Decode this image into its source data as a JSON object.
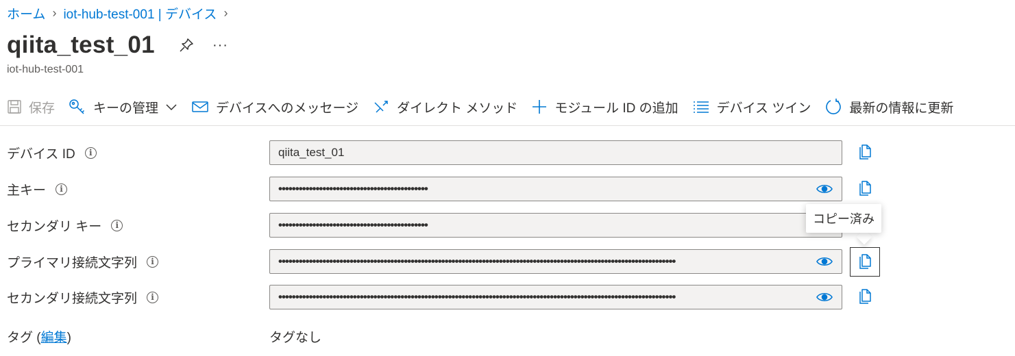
{
  "breadcrumb": {
    "items": [
      "ホーム",
      "iot-hub-test-001 | デバイス"
    ]
  },
  "header": {
    "title": "qiita_test_01",
    "subtitle": "iot-hub-test-001",
    "more_label": "···"
  },
  "toolbar": {
    "save": "保存",
    "manage_keys": "キーの管理",
    "message_to_device": "デバイスへのメッセージ",
    "direct_method": "ダイレクト メソッド",
    "add_module_identity": "モジュール ID の追加",
    "device_twin": "デバイス ツイン",
    "refresh": "最新の情報に更新"
  },
  "fields": {
    "device_id": {
      "label": "デバイス ID",
      "value": "qiita_test_01"
    },
    "primary_key": {
      "label": "主キー",
      "value": "••••••••••••••••••••••••••••••••••••••••••••"
    },
    "secondary_key": {
      "label": "セカンダリ キー",
      "value": "••••••••••••••••••••••••••••••••••••••••••••"
    },
    "primary_conn": {
      "label": "プライマリ接続文字列",
      "value": "•••••••••••••••••••••••••••••••••••••••••••••••••••••••••••••••••••••••••••••••••••••••••••••••••••••••••••••••••••••"
    },
    "secondary_conn": {
      "label": "セカンダリ接続文字列",
      "value": "•••••••••••••••••••••••••••••••••••••••••••••••••••••••••••••••••••••••••••••••••••••••••••••••••••••••••••••••••••••"
    }
  },
  "tooltip": {
    "text": "コピー済み"
  },
  "tags": {
    "label_prefix": "タグ (",
    "edit_link": "編集",
    "label_suffix": ")",
    "value": "タグなし"
  },
  "colors": {
    "accent": "#0078d4",
    "text": "#323130",
    "field_bg": "#f3f2f1",
    "disabled": "#a19f9d"
  },
  "icons": [
    "save-icon",
    "key-icon",
    "mail-icon",
    "direct-method-icon",
    "plus-icon",
    "list-icon",
    "refresh-icon",
    "pin-icon",
    "info-icon",
    "eye-icon",
    "copy-icon"
  ]
}
